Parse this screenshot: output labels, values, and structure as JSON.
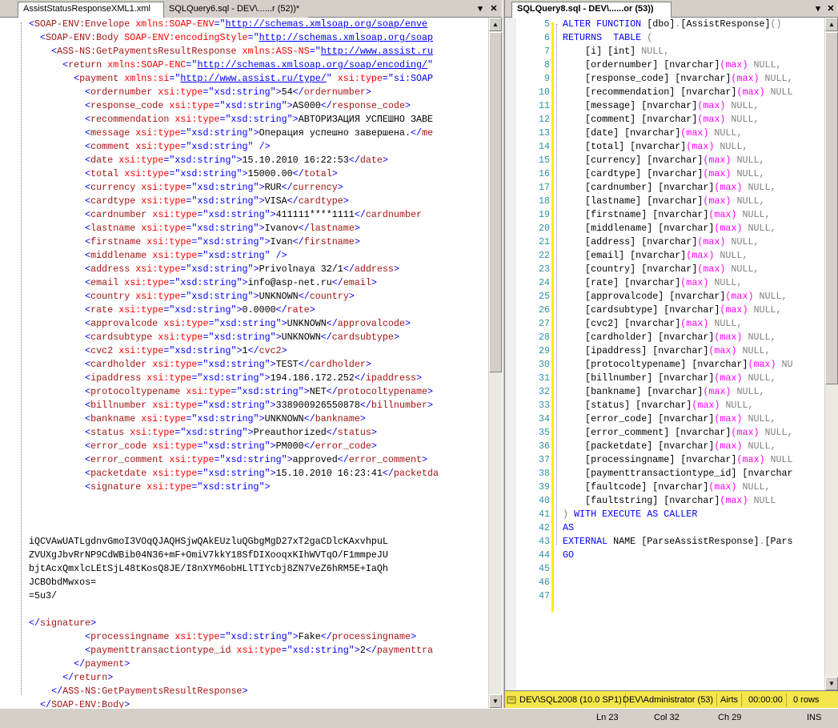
{
  "left_pane": {
    "tabs": [
      {
        "label": "AssistStatusResponseXML1.xml"
      },
      {
        "label": "SQLQuery6.sql - DEV\\......r (52))*"
      }
    ],
    "dropdown_glyph": "▾",
    "close_glyph": "✕",
    "xml_lines": [
      {
        "html": "<span class=\"b\">&lt;</span><span class=\"t\">SOAP-ENV:Envelope</span> <span class=\"a\">xmlns:SOAP-ENV</span><span class=\"b\">=\"</span><span class=\"u\">http://schemas.xmlsoap.org/soap/enve</span>"
      },
      {
        "html": "  <span class=\"b\">&lt;</span><span class=\"t\">SOAP-ENV:Body</span> <span class=\"a\">SOAP-ENV:encodingStyle</span><span class=\"b\">=\"</span><span class=\"u\">http://schemas.xmlsoap.org/soap</span>"
      },
      {
        "html": "    <span class=\"b\">&lt;</span><span class=\"t\">ASS-NS:GetPaymentsResultResponse</span> <span class=\"a\">xmlns:ASS-NS</span><span class=\"b\">=\"</span><span class=\"u\">http://www.assist.ru</span>"
      },
      {
        "html": "      <span class=\"b\">&lt;</span><span class=\"t\">return</span> <span class=\"a\">xmlns:SOAP-ENC</span><span class=\"b\">=\"</span><span class=\"u\">http://schemas.xmlsoap.org/soap/encoding/</span><span class=\"b\">\"</span>"
      },
      {
        "html": "        <span class=\"b\">&lt;</span><span class=\"t\">payment</span> <span class=\"a\">xmlns:si</span><span class=\"b\">=\"</span><span class=\"u\">http://www.assist.ru/type/</span><span class=\"b\">\"</span> <span class=\"a\">xsi:type</span><span class=\"b\">=\"si:SOAP</span>"
      },
      {
        "html": "          <span class=\"b\">&lt;</span><span class=\"t\">ordernumber</span> <span class=\"a\">xsi:type</span><span class=\"b\">=\"xsd:string\"&gt;</span>54<span class=\"b\">&lt;/</span><span class=\"t\">ordernumber</span><span class=\"b\">&gt;</span>"
      },
      {
        "html": "          <span class=\"b\">&lt;</span><span class=\"t\">response_code</span> <span class=\"a\">xsi:type</span><span class=\"b\">=\"xsd:string\"&gt;</span>AS000<span class=\"b\">&lt;/</span><span class=\"t\">response_code</span><span class=\"b\">&gt;</span>"
      },
      {
        "html": "          <span class=\"b\">&lt;</span><span class=\"t\">recommendation</span> <span class=\"a\">xsi:type</span><span class=\"b\">=\"xsd:string\"&gt;</span>АВТОРИЗАЦИЯ УСПЕШНО ЗАВЕ"
      },
      {
        "html": "          <span class=\"b\">&lt;</span><span class=\"t\">message</span> <span class=\"a\">xsi:type</span><span class=\"b\">=\"xsd:string\"&gt;</span>Операция успешно завершена.<span class=\"b\">&lt;/</span><span class=\"t\">me</span>"
      },
      {
        "html": "          <span class=\"b\">&lt;</span><span class=\"t\">comment</span> <span class=\"a\">xsi:type</span><span class=\"b\">=\"xsd:string\" /&gt;</span>"
      },
      {
        "html": "          <span class=\"b\">&lt;</span><span class=\"t\">date</span> <span class=\"a\">xsi:type</span><span class=\"b\">=\"xsd:string\"&gt;</span>15.10.2010 16:22:53<span class=\"b\">&lt;/</span><span class=\"t\">date</span><span class=\"b\">&gt;</span>"
      },
      {
        "html": "          <span class=\"b\">&lt;</span><span class=\"t\">total</span> <span class=\"a\">xsi:type</span><span class=\"b\">=\"xsd:string\"&gt;</span>15000.00<span class=\"b\">&lt;/</span><span class=\"t\">total</span><span class=\"b\">&gt;</span>"
      },
      {
        "html": "          <span class=\"b\">&lt;</span><span class=\"t\">currency</span> <span class=\"a\">xsi:type</span><span class=\"b\">=\"xsd:string\"&gt;</span>RUR<span class=\"b\">&lt;/</span><span class=\"t\">currency</span><span class=\"b\">&gt;</span>"
      },
      {
        "html": "          <span class=\"b\">&lt;</span><span class=\"t\">cardtype</span> <span class=\"a\">xsi:type</span><span class=\"b\">=\"xsd:string\"&gt;</span>VISA<span class=\"b\">&lt;/</span><span class=\"t\">cardtype</span><span class=\"b\">&gt;</span>"
      },
      {
        "html": "          <span class=\"b\">&lt;</span><span class=\"t\">cardnumber</span> <span class=\"a\">xsi:type</span><span class=\"b\">=\"xsd:string\"&gt;</span>411111****1111<span class=\"b\">&lt;/</span><span class=\"t\">cardnumber</span>"
      },
      {
        "html": "          <span class=\"b\">&lt;</span><span class=\"t\">lastname</span> <span class=\"a\">xsi:type</span><span class=\"b\">=\"xsd:string\"&gt;</span>Ivanov<span class=\"b\">&lt;/</span><span class=\"t\">lastname</span><span class=\"b\">&gt;</span>"
      },
      {
        "html": "          <span class=\"b\">&lt;</span><span class=\"t\">firstname</span> <span class=\"a\">xsi:type</span><span class=\"b\">=\"xsd:string\"&gt;</span>Ivan<span class=\"b\">&lt;/</span><span class=\"t\">firstname</span><span class=\"b\">&gt;</span>"
      },
      {
        "html": "          <span class=\"b\">&lt;</span><span class=\"t\">middlename</span> <span class=\"a\">xsi:type</span><span class=\"b\">=\"xsd:string\" /&gt;</span>"
      },
      {
        "html": "          <span class=\"b\">&lt;</span><span class=\"t\">address</span> <span class=\"a\">xsi:type</span><span class=\"b\">=\"xsd:string\"&gt;</span>Privolnaya 32/1<span class=\"b\">&lt;/</span><span class=\"t\">address</span><span class=\"b\">&gt;</span>"
      },
      {
        "html": "          <span class=\"b\">&lt;</span><span class=\"t\">email</span> <span class=\"a\">xsi:type</span><span class=\"b\">=\"xsd:string\"&gt;</span>info@asp-net.ru<span class=\"b\">&lt;/</span><span class=\"t\">email</span><span class=\"b\">&gt;</span>"
      },
      {
        "html": "          <span class=\"b\">&lt;</span><span class=\"t\">country</span> <span class=\"a\">xsi:type</span><span class=\"b\">=\"xsd:string\"&gt;</span>UNKNOWN<span class=\"b\">&lt;/</span><span class=\"t\">country</span><span class=\"b\">&gt;</span>"
      },
      {
        "html": "          <span class=\"b\">&lt;</span><span class=\"t\">rate</span> <span class=\"a\">xsi:type</span><span class=\"b\">=\"xsd:string\"&gt;</span>0.0000<span class=\"b\">&lt;/</span><span class=\"t\">rate</span><span class=\"b\">&gt;</span>"
      },
      {
        "html": "          <span class=\"b\">&lt;</span><span class=\"t\">approvalcode</span> <span class=\"a\">xsi:type</span><span class=\"b\">=\"xsd:string\"&gt;</span>UNKNOWN<span class=\"b\">&lt;/</span><span class=\"t\">approvalcode</span><span class=\"b\">&gt;</span>"
      },
      {
        "html": "          <span class=\"b\">&lt;</span><span class=\"t\">cardsubtype</span> <span class=\"a\">xsi:type</span><span class=\"b\">=\"xsd:string\"&gt;</span>UNKNOWN<span class=\"b\">&lt;/</span><span class=\"t\">cardsubtype</span><span class=\"b\">&gt;</span>"
      },
      {
        "html": "          <span class=\"b\">&lt;</span><span class=\"t\">cvc2</span> <span class=\"a\">xsi:type</span><span class=\"b\">=\"xsd:string\"&gt;</span>1<span class=\"b\">&lt;/</span><span class=\"t\">cvc2</span><span class=\"b\">&gt;</span>"
      },
      {
        "html": "          <span class=\"b\">&lt;</span><span class=\"t\">cardholder</span> <span class=\"a\">xsi:type</span><span class=\"b\">=\"xsd:string\"&gt;</span>TEST<span class=\"b\">&lt;/</span><span class=\"t\">cardholder</span><span class=\"b\">&gt;</span>"
      },
      {
        "html": "          <span class=\"b\">&lt;</span><span class=\"t\">ipaddress</span> <span class=\"a\">xsi:type</span><span class=\"b\">=\"xsd:string\"&gt;</span>194.186.172.252<span class=\"b\">&lt;/</span><span class=\"t\">ipaddress</span><span class=\"b\">&gt;</span>"
      },
      {
        "html": "          <span class=\"b\">&lt;</span><span class=\"t\">protocoltypename</span> <span class=\"a\">xsi:type</span><span class=\"b\">=\"xsd:string\"&gt;</span>NET<span class=\"b\">&lt;/</span><span class=\"t\">protocoltypename</span><span class=\"b\">&gt;</span>"
      },
      {
        "html": "          <span class=\"b\">&lt;</span><span class=\"t\">billnumber</span> <span class=\"a\">xsi:type</span><span class=\"b\">=\"xsd:string\"&gt;</span>338900926550878<span class=\"b\">&lt;/</span><span class=\"t\">billnumber</span><span class=\"b\">&gt;</span>"
      },
      {
        "html": "          <span class=\"b\">&lt;</span><span class=\"t\">bankname</span> <span class=\"a\">xsi:type</span><span class=\"b\">=\"xsd:string\"&gt;</span>UNKNOWN<span class=\"b\">&lt;/</span><span class=\"t\">bankname</span><span class=\"b\">&gt;</span>"
      },
      {
        "html": "          <span class=\"b\">&lt;</span><span class=\"t\">status</span> <span class=\"a\">xsi:type</span><span class=\"b\">=\"xsd:string\"&gt;</span>Preauthorized<span class=\"b\">&lt;/</span><span class=\"t\">status</span><span class=\"b\">&gt;</span>"
      },
      {
        "html": "          <span class=\"b\">&lt;</span><span class=\"t\">error_code</span> <span class=\"a\">xsi:type</span><span class=\"b\">=\"xsd:string\"&gt;</span>PM000<span class=\"b\">&lt;/</span><span class=\"t\">error_code</span><span class=\"b\">&gt;</span>"
      },
      {
        "html": "          <span class=\"b\">&lt;</span><span class=\"t\">error_comment</span> <span class=\"a\">xsi:type</span><span class=\"b\">=\"xsd:string\"&gt;</span>approved<span class=\"b\">&lt;/</span><span class=\"t\">error_comment</span><span class=\"b\">&gt;</span>"
      },
      {
        "html": "          <span class=\"b\">&lt;</span><span class=\"t\">packetdate</span> <span class=\"a\">xsi:type</span><span class=\"b\">=\"xsd:string\"&gt;</span>15.10.2010 16:23:41<span class=\"b\">&lt;/</span><span class=\"t\">packetda</span>"
      },
      {
        "html": "          <span class=\"b\">&lt;</span><span class=\"t\">signature</span> <span class=\"a\">xsi:type</span><span class=\"b\">=\"xsd:string\"&gt;</span>"
      },
      {
        "html": ""
      },
      {
        "html": ""
      },
      {
        "html": ""
      },
      {
        "html": "iQCVAwUATLgdnvGmoI3VOqQJAQHSjwQAkEUzluQGbgMgD27xT2gaCDlcKAxvhpuL"
      },
      {
        "html": "ZVUXgJbvRrNP9CdWBib04N36+mF+OmiV7kkY18SfDIXooqxKIhWVTqO/F1mmpeJU"
      },
      {
        "html": "bjtAcxQmxlcLEtSjL48tKosQ8JE/I8nXYM6obHLlTIYcbj8ZN7VeZ6hRM5E+IaQh"
      },
      {
        "html": "JCBObdMwxos="
      },
      {
        "html": "=5u3/"
      },
      {
        "html": ""
      },
      {
        "html": "<span class=\"b\">&lt;/</span><span class=\"t\">signature</span><span class=\"b\">&gt;</span>"
      },
      {
        "html": "          <span class=\"b\">&lt;</span><span class=\"t\">processingname</span> <span class=\"a\">xsi:type</span><span class=\"b\">=\"xsd:string\"&gt;</span>Fake<span class=\"b\">&lt;/</span><span class=\"t\">processingname</span><span class=\"b\">&gt;</span>"
      },
      {
        "html": "          <span class=\"b\">&lt;</span><span class=\"t\">paymenttransactiontype_id</span> <span class=\"a\">xsi:type</span><span class=\"b\">=\"xsd:string\"&gt;</span>2<span class=\"b\">&lt;/</span><span class=\"t\">paymenttra</span>"
      },
      {
        "html": "        <span class=\"b\">&lt;/</span><span class=\"t\">payment</span><span class=\"b\">&gt;</span>"
      },
      {
        "html": "      <span class=\"b\">&lt;/</span><span class=\"t\">return</span><span class=\"b\">&gt;</span>"
      },
      {
        "html": "    <span class=\"b\">&lt;/</span><span class=\"t\">ASS-NS:GetPaymentsResultResponse</span><span class=\"b\">&gt;</span>"
      },
      {
        "html": "  <span class=\"b\">&lt;/</span><span class=\"t\">SOAP-ENV:Body</span><span class=\"b\">&gt;</span>"
      }
    ]
  },
  "right_pane": {
    "tab_label": "SQLQuery8.sql - DEV\\......or (53))",
    "dropdown_glyph": "▾",
    "close_glyph": "✕",
    "line_numbers": [
      "5",
      "6",
      "7",
      "8",
      "9",
      "10",
      "11",
      "12",
      "13",
      "14",
      "15",
      "16",
      "17",
      "18",
      "19",
      "20",
      "21",
      "22",
      "23",
      "24",
      "25",
      "26",
      "27",
      "28",
      "29",
      "30",
      "31",
      "32",
      "33",
      "34",
      "35",
      "36",
      "37",
      "38",
      "39",
      "40",
      "41",
      "42",
      "43",
      "44",
      "45",
      "46",
      "47"
    ],
    "sql_lines": [
      {
        "html": "<span class=\"k\">ALTER FUNCTION</span> [dbo]<span class=\"g\">.</span>[AssistResponse]<span class=\"g\">()</span>"
      },
      {
        "html": "<span class=\"k\">RETURNS  TABLE</span> <span class=\"g\">(</span>"
      },
      {
        "html": "    [i] [int] <span class=\"g\">NULL,</span>"
      },
      {
        "html": "    [ordernumber] [nvarchar]<span class=\"m\">(max)</span> <span class=\"g\">NULL,</span>"
      },
      {
        "html": "    [response_code] [nvarchar]<span class=\"m\">(max)</span> <span class=\"g\">NULL,</span>"
      },
      {
        "html": "    [recommendation] [nvarchar]<span class=\"m\">(max)</span> <span class=\"g\">NULL</span>"
      },
      {
        "html": "    [message] [nvarchar]<span class=\"m\">(max)</span> <span class=\"g\">NULL,</span>"
      },
      {
        "html": "    [comment] [nvarchar]<span class=\"m\">(max)</span> <span class=\"g\">NULL,</span>"
      },
      {
        "html": "    [date] [nvarchar]<span class=\"m\">(max)</span> <span class=\"g\">NULL,</span>"
      },
      {
        "html": "    [total] [nvarchar]<span class=\"m\">(max)</span> <span class=\"g\">NULL,</span>"
      },
      {
        "html": "    [currency] [nvarchar]<span class=\"m\">(max)</span> <span class=\"g\">NULL,</span>"
      },
      {
        "html": "    [cardtype] [nvarchar]<span class=\"m\">(max)</span> <span class=\"g\">NULL,</span>"
      },
      {
        "html": "    [cardnumber] [nvarchar]<span class=\"m\">(max)</span> <span class=\"g\">NULL,</span>"
      },
      {
        "html": "    [lastname] [nvarchar]<span class=\"m\">(max)</span> <span class=\"g\">NULL,</span>"
      },
      {
        "html": "    [firstname] [nvarchar]<span class=\"m\">(max)</span> <span class=\"g\">NULL,</span>"
      },
      {
        "html": "    [middlename] [nvarchar]<span class=\"m\">(max)</span> <span class=\"g\">NULL,</span>"
      },
      {
        "html": "    [address] [nvarchar]<span class=\"m\">(max)</span> <span class=\"g\">NULL,</span>"
      },
      {
        "html": "    [email] [nvarchar]<span class=\"m\">(max)</span> <span class=\"g\">NULL,</span>"
      },
      {
        "html": "    [country] [nvarchar]<span class=\"m\">(max)</span> <span class=\"g\">NULL,</span>"
      },
      {
        "html": "    [rate] [nvarchar]<span class=\"m\">(max)</span> <span class=\"g\">NULL,</span>"
      },
      {
        "html": "    [approvalcode] [nvarchar]<span class=\"m\">(max)</span> <span class=\"g\">NULL,</span>"
      },
      {
        "html": "    [cardsubtype] [nvarchar]<span class=\"m\">(max)</span> <span class=\"g\">NULL,</span>"
      },
      {
        "html": "    [cvc2] [nvarchar]<span class=\"m\">(max)</span> <span class=\"g\">NULL,</span>"
      },
      {
        "html": "    [cardholder] [nvarchar]<span class=\"m\">(max)</span> <span class=\"g\">NULL,</span>"
      },
      {
        "html": "    [ipaddress] [nvarchar]<span class=\"m\">(max)</span> <span class=\"g\">NULL,</span>"
      },
      {
        "html": "    [protocoltypename] [nvarchar]<span class=\"m\">(max)</span> <span class=\"g\">NU</span>"
      },
      {
        "html": "    [billnumber] [nvarchar]<span class=\"m\">(max)</span> <span class=\"g\">NULL,</span>"
      },
      {
        "html": "    [bankname] [nvarchar]<span class=\"m\">(max)</span> <span class=\"g\">NULL,</span>"
      },
      {
        "html": "    [status] [nvarchar]<span class=\"m\">(max)</span> <span class=\"g\">NULL,</span>"
      },
      {
        "html": "    [error_code] [nvarchar]<span class=\"m\">(max)</span> <span class=\"g\">NULL,</span>"
      },
      {
        "html": "    [error_comment] [nvarchar]<span class=\"m\">(max)</span> <span class=\"g\">NULL,</span>"
      },
      {
        "html": "    [packetdate] [nvarchar]<span class=\"m\">(max)</span> <span class=\"g\">NULL,</span>"
      },
      {
        "html": "    [processingname] [nvarchar]<span class=\"m\">(max)</span> <span class=\"g\">NULL</span>"
      },
      {
        "html": "    [paymenttransactiontype_id] [nvarchar"
      },
      {
        "html": "    [faultcode] [nvarchar]<span class=\"m\">(max)</span> <span class=\"g\">NULL,</span>"
      },
      {
        "html": "    [faultstring] [nvarchar]<span class=\"m\">(max)</span> <span class=\"g\">NULL</span>"
      },
      {
        "html": "<span class=\"g\">)</span> <span class=\"k\">WITH EXECUTE AS CALLER</span>"
      },
      {
        "html": "<span class=\"k\">AS</span>"
      },
      {
        "html": "<span class=\"k\">EXTERNAL</span> NAME [ParseAssistResponse]<span class=\"g\">.</span>[Pars"
      },
      {
        "html": "<span class=\"k\">GO</span>"
      },
      {
        "html": ""
      },
      {
        "html": ""
      },
      {
        "html": ""
      }
    ],
    "status": {
      "server": "DEV\\SQL2008 (10.0 SP1)",
      "user": "DEV\\Administrator (53)",
      "database": "Airts",
      "elapsed": "00:00:00",
      "rows": "0 rows"
    }
  },
  "bottom_status": {
    "ln": "Ln 23",
    "col": "Col 32",
    "ch": "Ch 29",
    "ins": "INS"
  }
}
